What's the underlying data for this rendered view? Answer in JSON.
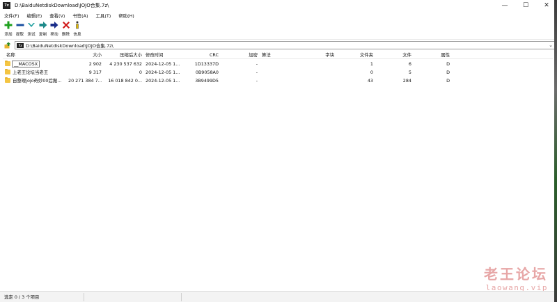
{
  "window": {
    "title": "D:\\BaiduNetdiskDownload\\JOJO合集.7z\\",
    "app_icon": "7z-icon",
    "controls": {
      "minimize": "—",
      "maximize": "☐",
      "close": "✕"
    }
  },
  "menu": [
    "文件(F)",
    "编辑(E)",
    "查看(V)",
    "书签(A)",
    "工具(T)",
    "帮助(H)"
  ],
  "toolbar": [
    {
      "label": "添加",
      "icon": "plus-icon",
      "color": "#1ea01e"
    },
    {
      "label": "提取",
      "icon": "minus-icon",
      "color": "#1a4fa0"
    },
    {
      "label": "测试",
      "icon": "check-chevron-icon",
      "color": "#22a0a0"
    },
    {
      "label": "复制",
      "icon": "arrow-right-icon",
      "color": "#1e8a8a"
    },
    {
      "label": "移动",
      "icon": "arrow-right-icon",
      "color": "#1a2e8a"
    },
    {
      "label": "删除",
      "icon": "x-icon",
      "color": "#d01818"
    },
    {
      "label": "信息",
      "icon": "info-icon",
      "color": "#e0b800"
    }
  ],
  "address": {
    "path": "D:\\BaiduNetdiskDownload\\JOJO合集.7z\\"
  },
  "columns": {
    "name": "名称",
    "size": "大小",
    "packed": "压缩后大小",
    "modified": "修改时间",
    "crc": "CRC",
    "encrypted": "加密",
    "method": "算法",
    "chars": "字块",
    "folders": "文件夹",
    "files": "文件",
    "attr": "属性"
  },
  "rows": [
    {
      "name": "__MACOSX",
      "size": "2 902",
      "packed": "4 230 537 632",
      "modified": "2024-12-05 1...",
      "crc": "1D13337D",
      "encrypted": "-",
      "folders": "1",
      "files": "6",
      "attr": "D",
      "selected": true
    },
    {
      "name": "上老王论坛当老王",
      "size": "9 317",
      "packed": "0",
      "modified": "2024-12-05 1...",
      "crc": "0B9058A0",
      "encrypted": "-",
      "folders": "0",
      "files": "5",
      "attr": "D",
      "selected": false
    },
    {
      "name": "自整理jojo奇妙00后搬...",
      "size": "20 271 384 7...",
      "packed": "16 018 842 0...",
      "modified": "2024-12-05 1...",
      "crc": "3B9499D5",
      "encrypted": "-",
      "folders": "43",
      "files": "284",
      "attr": "D",
      "selected": false
    }
  ],
  "status": {
    "text": "选定 0 / 3 个项目"
  },
  "watermark": {
    "cn": "老王论坛",
    "url": "laowang.vip"
  }
}
